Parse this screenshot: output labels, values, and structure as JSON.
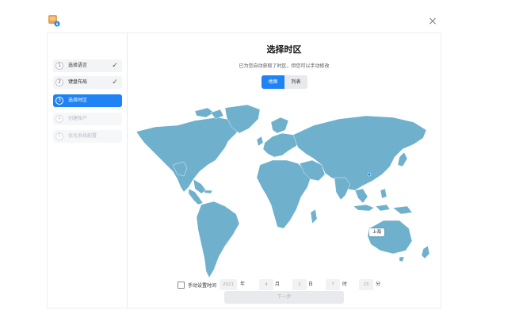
{
  "window": {
    "close_symbol": "×",
    "logo_icon": "installer-logo-icon"
  },
  "sidebar": {
    "steps": [
      {
        "number": "1",
        "label": "选择语言",
        "state": "done"
      },
      {
        "number": "2",
        "label": "键盘布局",
        "state": "done"
      },
      {
        "number": "3",
        "label": "选择时区",
        "state": "active"
      },
      {
        "number": "4",
        "label": "创建账户",
        "state": "disabled"
      },
      {
        "number": "5",
        "label": "优化系统配置",
        "state": "disabled"
      }
    ],
    "check_symbol": "✓"
  },
  "main": {
    "title": "选择时区",
    "subtitle": "已为您自动获取了时区，但您可以手动修改",
    "view_tabs": [
      {
        "label": "地图",
        "selected": true
      },
      {
        "label": "列表",
        "selected": false
      }
    ],
    "map": {
      "selected_city": "上海",
      "land_color": "#6fb0cd",
      "pin_color": "#1f82f5"
    },
    "manual_time": {
      "label": "手动设置时间",
      "checked": false,
      "year": "2021",
      "year_unit": "年",
      "month": "4",
      "month_unit": "月",
      "day": "2",
      "day_unit": "日",
      "hour": "7",
      "hour_unit": "时",
      "minute": "15",
      "minute_unit": "分"
    },
    "next_label": "下一步"
  },
  "colors": {
    "accent": "#1f82f5",
    "disabled_text": "#b5bac3"
  }
}
